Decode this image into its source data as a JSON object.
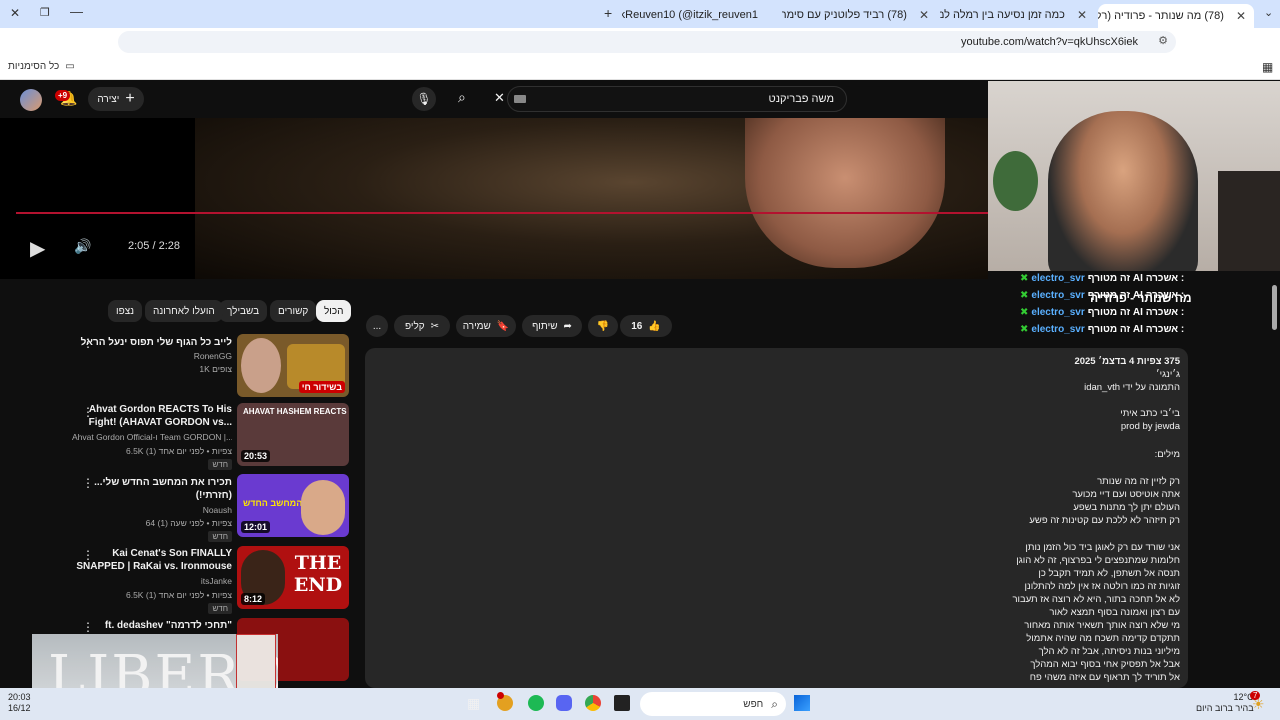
{
  "browser": {
    "tabs": [
      {
        "title": "(78) מה שנותר - פרודיה (רק לע...",
        "active": true,
        "favicon_color": "#ff0000"
      },
      {
        "title": "כמה זמן נסיעה בין רמלה למודיע...",
        "active": false,
        "favicon_color": "#4285f4"
      },
      {
        "title": "(78) רביד פלוטניק עם סימה נגן",
        "active": false,
        "favicon_color": "#ff0000"
      },
      {
        "title": "ItzikReuven10 (@itzik_reuven1...",
        "active": false,
        "favicon_color": "#111111"
      }
    ],
    "new_tab_symbol": "+",
    "url": "youtube.com/watch?v=qkUhscX6iek",
    "bookmarks_label": "כל הסימניות"
  },
  "youtube": {
    "search_value": "משה פבריקנט",
    "create_label": "יצירה",
    "notif_count": "+9",
    "player": {
      "time": "2:05 / 2:28"
    },
    "chat": [
      {
        "prefix": "זה מטורף AI אשכרה :",
        "user": "electro_svr"
      },
      {
        "prefix": "זה מטורף AI אשכרה :",
        "user": "electro_svr"
      },
      {
        "prefix": "זה מטורף AI אשכרה :",
        "user": "electro_svr"
      },
      {
        "prefix": "זה מטורף AI אשכרה :",
        "user": "electro_svr"
      }
    ],
    "video_title_overlay": "מה שנותר - פרודיה",
    "actions": {
      "likes": "16",
      "share": "שיתוף",
      "save": "שמירה",
      "clip": "קליפ",
      "more": "..."
    },
    "chips": [
      "הכול",
      "קשורים",
      "בשבילך",
      "הועלו לאחרונה",
      "נצפו"
    ],
    "description": {
      "stats": "375 צפיות  4 בדצמ׳ 2025",
      "lines": [
        "ג׳ינגי׳",
        "התמונה על ידי idan_vth",
        "",
        "בי׳בי כתב איתי",
        "prod by jewda",
        "",
        "מילים:",
        "",
        "רק לזיין זה מה שנותר",
        "אתה אוטיסט ועם דיי מכוער",
        "העולם יתן לך מתנות בשפע",
        "רק תיזהר לא ללכת עם קטינות זה פשע",
        "",
        "אני שורד עם רק לאוגן ביד כול הזמן נותן",
        "חלומות שמתנפצים לי בפרצוף, זה לא הוגן",
        "תנסה אל תשתפן, לא תמיד תקבל כן",
        "זוגיות זה כמו רולטה אז אין למה להתלונן",
        "לא אל תחכה בתור, היא לא רוצה אז תעבור",
        "עם רצון ואמונה בסוף תמצא לאור",
        "מי שלא רוצה אותך תשאיר אותה מאחור",
        "תתקדם קדימה תשכח מה שהיה אתמול",
        "מיליוני בנות ניסיתה, אבל זה לא הלך",
        "אבל אל תפסיק אחי בסוף יבוא המהלך",
        "אל תוריד לך תראוף עם איזה משהי פח"
      ]
    },
    "recommendations": [
      {
        "title": "לייב כל הגוף שלי תפוס ינעל הראל",
        "channel": "RonenGG",
        "meta": "1K צופים",
        "duration": "בשידור חי",
        "badge": "",
        "thumb_color": "#7a5a2a"
      },
      {
        "title": "Ahvat Gordon REACTS To His Fight!  (AHAVAT GORDON vs...",
        "channel": "Ahvat Gordon Official-ו Team GORDON |...",
        "meta": "6.5K צפיות • לפני יום אחד (1)",
        "duration": "20:53",
        "badge": "חדש",
        "thumb_color": "#5a3a3a"
      },
      {
        "title": "תכירו את המחשב החדש שלי... (חזרתי!)",
        "channel": "Noaush",
        "meta": "64 צפיות • לפני שעה (1)",
        "duration": "12:01",
        "badge": "חדש",
        "thumb_color": "#6a3ad0"
      },
      {
        "title": "Kai Cenat's Son FINALLY SNAPPED | RaKai vs. Ironmouse",
        "channel": "itsJanke",
        "meta": "6.5K צפיות • לפני יום אחד (1)",
        "duration": "8:12",
        "badge": "חדש",
        "thumb_color": "#b01010"
      },
      {
        "title": "ft. dedashev \"תחכי לדרמה\"",
        "channel": "",
        "meta": "",
        "duration": "",
        "badge": "",
        "thumb_color": "#8a1010"
      }
    ],
    "thumb_texts": [
      "THE END",
      "AHAVAT HASHEM REACTS",
      "תכירו את המחשב החדש"
    ]
  },
  "overlay": {
    "brand": "LIBERO"
  },
  "taskbar": {
    "time": "20:03",
    "date": "16/12",
    "search_label": "חפש",
    "weather_temp": "12°C",
    "weather_desc": "בהיר ברוב היום",
    "notif": "7"
  },
  "colors": {
    "accent": "#ff0033",
    "progress": "#b3122f",
    "chat_user": "#5ab0ff"
  }
}
